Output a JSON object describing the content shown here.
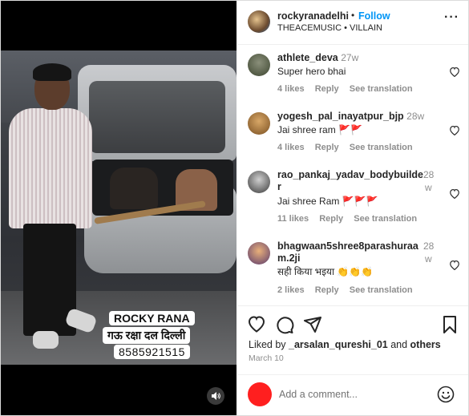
{
  "post": {
    "username": "rockyranadelhi",
    "follow_label": "Follow",
    "subtitle": "THEACEMUSIC • VILLAIN",
    "more_label": "···"
  },
  "media": {
    "caption_line1": "ROCKY RANA",
    "caption_line2": "गऊ रक्षा दल दिल्ली",
    "caption_line3": "8585921515"
  },
  "comments": [
    {
      "user": "athlete_deva",
      "time": "27w",
      "text": "Super hero bhai",
      "likes": "4 likes",
      "reply": "Reply",
      "translate": "See translation"
    },
    {
      "user": "yogesh_pal_inayatpur_bjp",
      "time": "28w",
      "text": "Jai shree ram 🚩🚩",
      "likes": "4 likes",
      "reply": "Reply",
      "translate": "See translation"
    },
    {
      "user_line1": "rao_pankaj_yadav_bodybuilde",
      "user_line2": "r",
      "time": "28",
      "time2": "w",
      "text": "Jai shree Ram 🚩🚩🚩",
      "likes": "11 likes",
      "reply": "Reply",
      "translate": "See translation"
    },
    {
      "user_line1": "bhagwaan5shree8parashuraa",
      "user_line2": "m.2ji",
      "time": "28",
      "time2": "w",
      "text": "सही किया भइया 👏👏👏",
      "likes": "2 likes",
      "reply": "Reply",
      "translate": "See translation"
    }
  ],
  "footer": {
    "liked_prefix": "Liked by ",
    "liked_user": "_arsalan_qureshi_01",
    "liked_and": " and ",
    "liked_others": "others",
    "date": "March 10",
    "add_comment_placeholder": "Add a comment..."
  },
  "colors": {
    "accent": "#0095f6",
    "avatar_red": "#ff1f1f"
  }
}
